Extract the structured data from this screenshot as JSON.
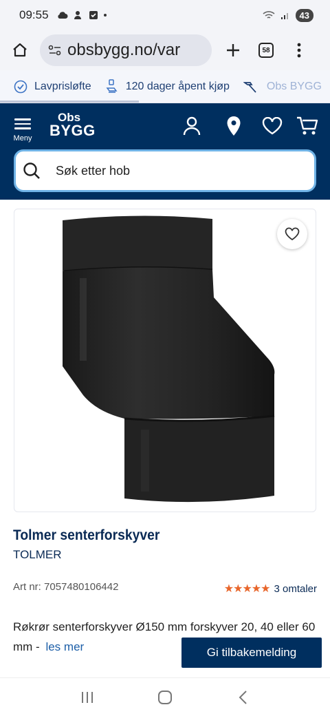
{
  "status_bar": {
    "time": "09:55",
    "battery": "43"
  },
  "browser": {
    "url": "obsbygg.no/var",
    "tab_count": "58"
  },
  "usp": [
    {
      "label": "Lavprisløfte",
      "icon": "check-circle-icon"
    },
    {
      "label": "120 dager åpent kjøp",
      "icon": "return-icon"
    },
    {
      "label": "Obs BYGG",
      "icon": "hammer-icon"
    }
  ],
  "header": {
    "menu_label": "Meny",
    "logo_top": "Obs",
    "logo_bottom": "BYGG"
  },
  "search": {
    "placeholder": "Søk etter hob"
  },
  "product": {
    "title": "Tolmer senterforskyver",
    "brand": "TOLMER",
    "art_nr": "Art nr: 7057480106442",
    "stars": "★★★★★",
    "rating": 5,
    "reviews": "3 omtaler",
    "description": "Røkrør senterforskyver Ø150 mm forskyver 20, 40 eller 60 mm -",
    "read_more": "les mer"
  },
  "feedback_button": "Gi tilbakemelding",
  "colors": {
    "header_bg": "#002f5f",
    "accent_orange": "#e8662b",
    "link_blue": "#1d5fa8",
    "search_border": "#6fb3e6"
  }
}
